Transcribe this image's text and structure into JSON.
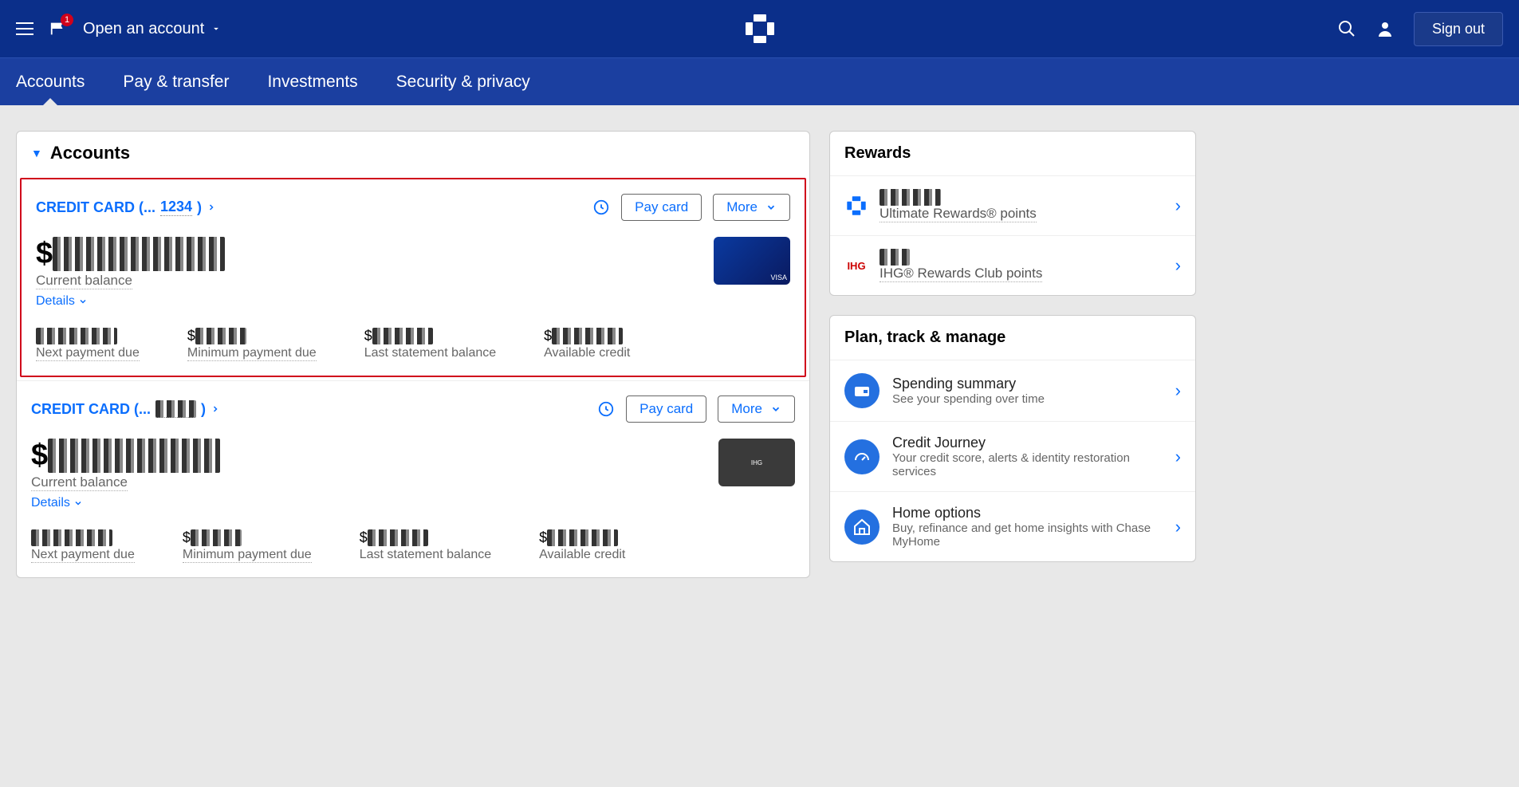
{
  "header": {
    "notif_count": "1",
    "open_account": "Open an account",
    "signout": "Sign out"
  },
  "nav": {
    "items": [
      "Accounts",
      "Pay & transfer",
      "Investments",
      "Security & privacy"
    ],
    "active_index": 0
  },
  "accounts": {
    "section_title": "Accounts",
    "cards": [
      {
        "title_prefix": "CREDIT CARD (...",
        "last4": "1234",
        "title_suffix": ")",
        "pay_label": "Pay card",
        "more_label": "More",
        "balance_prefix": "$",
        "balance_redacted": "████████",
        "balance_label": "Current balance",
        "details_label": "Details",
        "card_network": "VISA",
        "stats": [
          {
            "val_redacted": "████████",
            "label": "Next payment due"
          },
          {
            "val_prefix": "$",
            "val_redacted": "█████",
            "label": "Minimum payment due"
          },
          {
            "val_prefix": "$",
            "val_redacted": "██████",
            "label": "Last statement balance",
            "nodot": true
          },
          {
            "val_prefix": "$",
            "val_redacted": "███████",
            "label": "Available credit",
            "nodot": true
          }
        ]
      },
      {
        "title_prefix": "CREDIT CARD (...",
        "last4": "████",
        "title_suffix": ")",
        "pay_label": "Pay card",
        "more_label": "More",
        "balance_prefix": "$",
        "balance_redacted": "████████",
        "balance_label": "Current balance",
        "details_label": "Details",
        "card_network": "IHG",
        "stats": [
          {
            "val_redacted": "████████",
            "label": "Next payment due"
          },
          {
            "val_prefix": "$",
            "val_redacted": "█████",
            "label": "Minimum payment due"
          },
          {
            "val_prefix": "$",
            "val_redacted": "██████",
            "label": "Last statement balance",
            "nodot": true
          },
          {
            "val_prefix": "$",
            "val_redacted": "███████",
            "label": "Available credit",
            "nodot": true
          }
        ]
      }
    ]
  },
  "rewards": {
    "title": "Rewards",
    "items": [
      {
        "logo": "chase",
        "val_redacted": "██████",
        "label": "Ultimate Rewards® points"
      },
      {
        "logo": "ihg",
        "logo_text": "IHG",
        "val_redacted": "███",
        "label": "IHG® Rewards Club points"
      }
    ]
  },
  "plan": {
    "title": "Plan, track & manage",
    "items": [
      {
        "icon": "wallet",
        "title": "Spending summary",
        "desc": "See your spending over time"
      },
      {
        "icon": "gauge",
        "title": "Credit Journey",
        "desc": "Your credit score, alerts & identity restoration services"
      },
      {
        "icon": "home",
        "title": "Home options",
        "desc": "Buy, refinance and get home insights with Chase MyHome"
      }
    ]
  }
}
